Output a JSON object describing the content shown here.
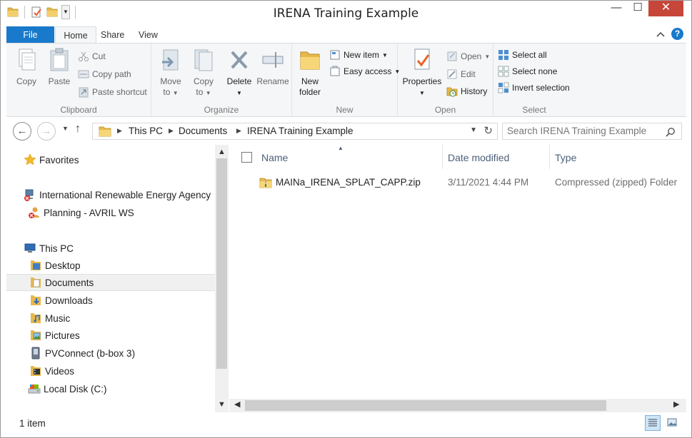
{
  "window": {
    "title": "IRENA Training Example"
  },
  "qat": {
    "icons": [
      "folder-icon",
      "properties-icon",
      "new-folder-icon",
      "customize-dropdown-icon"
    ]
  },
  "title_buttons": {
    "minimize": "—",
    "maximize": "☐",
    "close": "✕"
  },
  "tabs": [
    {
      "label": "File"
    },
    {
      "label": "Home"
    },
    {
      "label": "Share"
    },
    {
      "label": "View"
    }
  ],
  "ribbon": {
    "clipboard": {
      "label": "Clipboard",
      "copy": "Copy",
      "paste": "Paste",
      "cut": "Cut",
      "copy_path": "Copy path",
      "paste_shortcut": "Paste shortcut"
    },
    "organize": {
      "label": "Organize",
      "move_to": "Move",
      "move_to_2": "to",
      "copy_to": "Copy",
      "copy_to_2": "to",
      "delete": "Delete",
      "rename": "Rename"
    },
    "new": {
      "label": "New",
      "new_folder": "New",
      "new_folder_2": "folder",
      "new_item": "New item",
      "easy_access": "Easy access"
    },
    "open": {
      "label": "Open",
      "properties": "Properties",
      "open": "Open",
      "edit": "Edit",
      "history": "History"
    },
    "select": {
      "label": "Select",
      "select_all": "Select all",
      "select_none": "Select none",
      "invert_selection": "Invert selection"
    }
  },
  "address": {
    "crumbs": [
      "This PC",
      "Documents",
      "IRENA Training Example"
    ],
    "search_placeholder": "Search IRENA Training Example"
  },
  "navpane": {
    "items": [
      {
        "label": "Favorites",
        "icon": "star-icon"
      },
      {
        "label": "International Renewable Energy Agency",
        "icon": "network-icon"
      },
      {
        "label": "Planning - AVRIL WS",
        "icon": "network-user-icon"
      },
      {
        "label": "This PC",
        "icon": "computer-icon"
      },
      {
        "label": "Desktop",
        "icon": "desktop-folder-icon"
      },
      {
        "label": "Documents",
        "icon": "documents-folder-icon"
      },
      {
        "label": "Downloads",
        "icon": "downloads-folder-icon"
      },
      {
        "label": "Music",
        "icon": "music-folder-icon"
      },
      {
        "label": "Pictures",
        "icon": "pictures-folder-icon"
      },
      {
        "label": "PVConnect (b-box 3)",
        "icon": "device-icon"
      },
      {
        "label": "Videos",
        "icon": "videos-folder-icon"
      },
      {
        "label": "Local Disk (C:)",
        "icon": "drive-icon"
      }
    ],
    "selected": "Documents"
  },
  "filelist": {
    "columns": {
      "name": "Name",
      "date": "Date modified",
      "type": "Type"
    },
    "rows": [
      {
        "name": "MAINa_IRENA_SPLAT_CAPP.zip",
        "date": "3/11/2021 4:44 PM",
        "type": "Compressed (zipped) Folder"
      }
    ]
  },
  "status": {
    "count": "1 item"
  },
  "colors": {
    "accent": "#1979ca",
    "close": "#c7463a",
    "folder": "#e8b84a"
  }
}
